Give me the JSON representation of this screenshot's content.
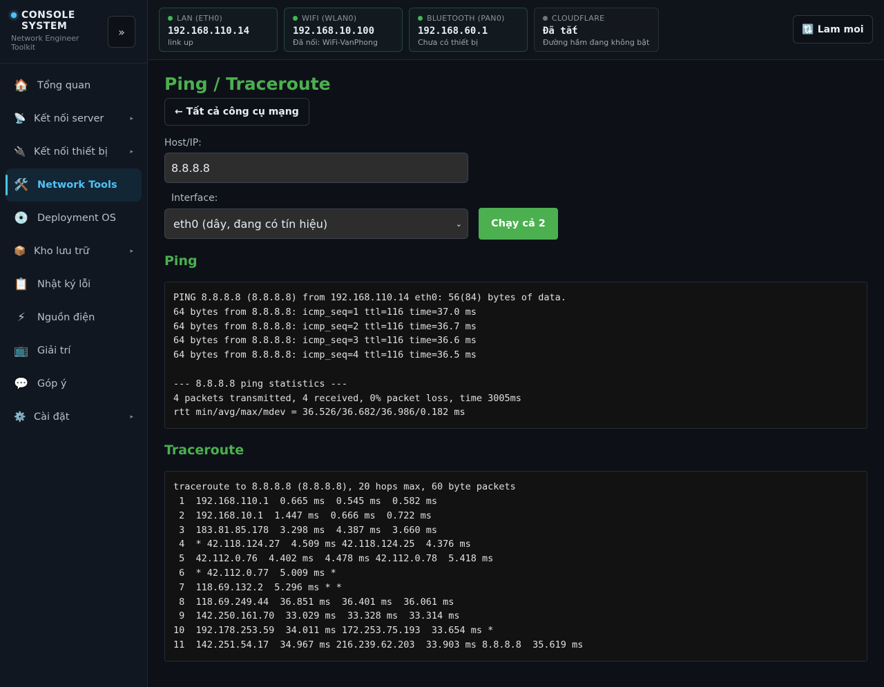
{
  "brand": {
    "title": "CONSOLE SYSTEM",
    "subtitle": "Network Engineer Toolkit",
    "collapse_label": "»"
  },
  "sidebar": {
    "items": [
      {
        "label": "Tổng quan",
        "icon": "🏠"
      },
      {
        "label": "Kết nối server",
        "icon": "📡"
      },
      {
        "label": "Kết nối thiết bị",
        "icon": "🔌"
      },
      {
        "label": "Network Tools",
        "icon": "🛠️"
      },
      {
        "label": "Deployment OS",
        "icon": "💿"
      },
      {
        "label": "Kho lưu trữ",
        "icon": "📦"
      },
      {
        "label": "Nhật ký lỗi",
        "icon": "📋"
      },
      {
        "label": "Nguồn điện",
        "icon": "⚡"
      },
      {
        "label": "Giải trí",
        "icon": "📺"
      },
      {
        "label": "Góp ý",
        "icon": "💬"
      },
      {
        "label": "Cài đặt",
        "icon": "⚙️"
      }
    ],
    "chevron": "▸"
  },
  "status": {
    "lan": {
      "label": "LAN (ETH0)",
      "ip": "192.168.110.14",
      "detail": "link up"
    },
    "wifi": {
      "label": "WIFI (WLAN0)",
      "ip": "192.168.10.100",
      "detail": "Đã nối: WiFi-VanPhong"
    },
    "bluetooth": {
      "label": "BLUETOOTH (PAN0)",
      "ip": "192.168.60.1",
      "detail": "Chưa có thiết bị"
    },
    "cloudflare": {
      "label": "CLOUDFLARE",
      "ip": "Đã tắt",
      "detail": "Đường hầm đang không bật"
    },
    "refresh_label": "🔃 Lam moi",
    "colors": {
      "online": "#3fb950",
      "offline": "#6e7681"
    }
  },
  "main": {
    "title": "Ping / Traceroute",
    "back_label": "← Tất cả công cụ mạng",
    "host_label": "Host/IP:",
    "host_value": "8.8.8.8",
    "interface_label": "Interface:",
    "interface_value": "eth0 (dây, đang có tín hiệu)",
    "run_label": "Chạy cả 2",
    "accent": "#4caf50",
    "ping_title": "Ping",
    "ping_output": "PING 8.8.8.8 (8.8.8.8) from 192.168.110.14 eth0: 56(84) bytes of data.\n64 bytes from 8.8.8.8: icmp_seq=1 ttl=116 time=37.0 ms\n64 bytes from 8.8.8.8: icmp_seq=2 ttl=116 time=36.7 ms\n64 bytes from 8.8.8.8: icmp_seq=3 ttl=116 time=36.6 ms\n64 bytes from 8.8.8.8: icmp_seq=4 ttl=116 time=36.5 ms\n\n--- 8.8.8.8 ping statistics ---\n4 packets transmitted, 4 received, 0% packet loss, time 3005ms\nrtt min/avg/max/mdev = 36.526/36.682/36.986/0.182 ms",
    "trace_title": "Traceroute",
    "trace_output": "traceroute to 8.8.8.8 (8.8.8.8), 20 hops max, 60 byte packets\n 1  192.168.110.1  0.665 ms  0.545 ms  0.582 ms\n 2  192.168.10.1  1.447 ms  0.666 ms  0.722 ms\n 3  183.81.85.178  3.298 ms  4.387 ms  3.660 ms\n 4  * 42.118.124.27  4.509 ms 42.118.124.25  4.376 ms\n 5  42.112.0.76  4.402 ms  4.478 ms 42.112.0.78  5.418 ms\n 6  * 42.112.0.77  5.009 ms *\n 7  118.69.132.2  5.296 ms * *\n 8  118.69.249.44  36.851 ms  36.401 ms  36.061 ms\n 9  142.250.161.70  33.029 ms  33.328 ms  33.314 ms\n10  192.178.253.59  34.011 ms 172.253.75.193  33.654 ms *\n11  142.251.54.17  34.967 ms 216.239.62.203  33.903 ms 8.8.8.8  35.619 ms"
  }
}
